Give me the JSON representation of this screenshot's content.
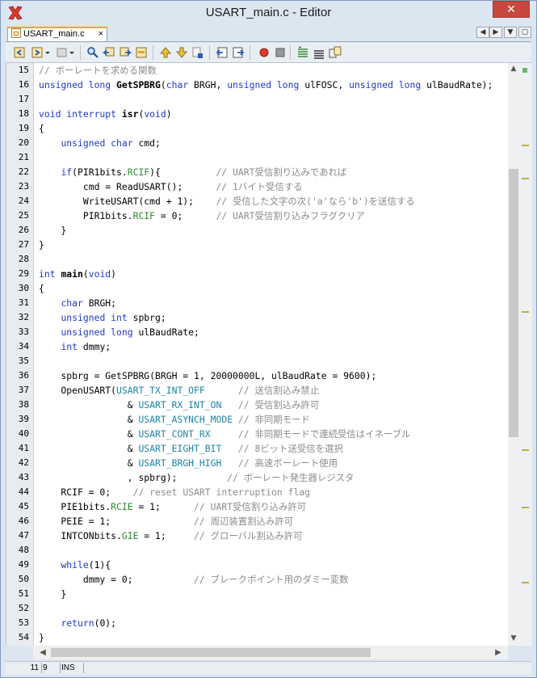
{
  "window": {
    "title": "USART_main.c - Editor",
    "close_glyph": "✕"
  },
  "tab": {
    "label": "USART_main.c",
    "close_glyph": "×"
  },
  "tab_nav": {
    "prev": "◀",
    "next": "▶",
    "list": "▼",
    "maximize": "▢"
  },
  "toolbar_icons": [
    "back-icon",
    "forward-icon",
    "last-edit-icon",
    "find-icon",
    "find-prev-icon",
    "find-next-icon",
    "toggle-highlight-icon",
    "prev-bookmark-icon",
    "next-bookmark-icon",
    "toggle-bookmark-icon",
    "shift-left-icon",
    "shift-right-icon",
    "start-macro-icon",
    "stop-macro-icon",
    "comment-icon",
    "uncomment-icon",
    "diff-icon"
  ],
  "editor": {
    "current_line": 11,
    "lines": [
      {
        "n": "15",
        "segs": [
          [
            "cm",
            "// ボーレートを求める関数"
          ]
        ]
      },
      {
        "n": "16",
        "segs": [
          [
            "kw",
            "unsigned long "
          ],
          [
            "fn",
            "GetSPBRG"
          ],
          [
            "",
            "("
          ],
          [
            "kw",
            "char"
          ],
          [
            "",
            " BRGH, "
          ],
          [
            "kw",
            "unsigned long"
          ],
          [
            "",
            " ulFOSC, "
          ],
          [
            "kw",
            "unsigned long"
          ],
          [
            "",
            " ulBaudRate);"
          ]
        ]
      },
      {
        "n": "17",
        "segs": []
      },
      {
        "n": "18",
        "segs": [
          [
            "kw",
            "void interrupt "
          ],
          [
            "fn",
            "isr"
          ],
          [
            "",
            "("
          ],
          [
            "kw",
            "void"
          ],
          [
            "",
            ")"
          ]
        ]
      },
      {
        "n": "19",
        "segs": [
          [
            "",
            "{"
          ]
        ]
      },
      {
        "n": "20",
        "segs": [
          [
            "",
            "    "
          ],
          [
            "kw",
            "unsigned char"
          ],
          [
            "",
            " cmd;"
          ]
        ]
      },
      {
        "n": "21",
        "segs": []
      },
      {
        "n": "22",
        "segs": [
          [
            "",
            "    "
          ],
          [
            "kw",
            "if"
          ],
          [
            "",
            "(PIR1bits."
          ],
          [
            "gr",
            "RCIF"
          ],
          [
            "",
            "){          "
          ],
          [
            "cm",
            "// UART受信割り込みであれば"
          ]
        ]
      },
      {
        "n": "23",
        "segs": [
          [
            "",
            "        cmd = ReadUSART();      "
          ],
          [
            "cm",
            "// 1バイト受信する"
          ]
        ]
      },
      {
        "n": "24",
        "segs": [
          [
            "",
            "        WriteUSART(cmd + 1);    "
          ],
          [
            "cm",
            "// 受信した文字の次('a'なら'b')を送信する"
          ]
        ]
      },
      {
        "n": "25",
        "segs": [
          [
            "",
            "        PIR1bits."
          ],
          [
            "gr",
            "RCIF"
          ],
          [
            "",
            " = 0;      "
          ],
          [
            "cm",
            "// UART受信割り込みフラグクリア"
          ]
        ]
      },
      {
        "n": "26",
        "segs": [
          [
            "",
            "    }"
          ]
        ]
      },
      {
        "n": "27",
        "segs": [
          [
            "",
            "}"
          ]
        ]
      },
      {
        "n": "28",
        "segs": []
      },
      {
        "n": "29",
        "segs": [
          [
            "kw",
            "int "
          ],
          [
            "fn",
            "main"
          ],
          [
            "",
            "("
          ],
          [
            "kw",
            "void"
          ],
          [
            "",
            ")"
          ]
        ]
      },
      {
        "n": "30",
        "segs": [
          [
            "",
            "{"
          ]
        ]
      },
      {
        "n": "31",
        "segs": [
          [
            "",
            "    "
          ],
          [
            "kw",
            "char"
          ],
          [
            "",
            " BRGH;"
          ]
        ]
      },
      {
        "n": "32",
        "segs": [
          [
            "",
            "    "
          ],
          [
            "kw",
            "unsigned int"
          ],
          [
            "",
            " spbrg;"
          ]
        ]
      },
      {
        "n": "33",
        "segs": [
          [
            "",
            "    "
          ],
          [
            "kw",
            "unsigned long"
          ],
          [
            "",
            " ulBaudRate;"
          ]
        ]
      },
      {
        "n": "34",
        "segs": [
          [
            "",
            "    "
          ],
          [
            "kw",
            "int"
          ],
          [
            "",
            " dmmy;"
          ]
        ]
      },
      {
        "n": "35",
        "segs": []
      },
      {
        "n": "36",
        "segs": [
          [
            "",
            "    spbrg = GetSPBRG(BRGH = 1, 20000000L, ulBaudRate = 9600);"
          ]
        ]
      },
      {
        "n": "37",
        "segs": [
          [
            "",
            "    OpenUSART("
          ],
          [
            "cy",
            "USART_TX_INT_OFF"
          ],
          [
            "",
            "      "
          ],
          [
            "cm",
            "// 送信割込み禁止"
          ]
        ]
      },
      {
        "n": "38",
        "segs": [
          [
            "",
            "                & "
          ],
          [
            "cy",
            "USART_RX_INT_ON"
          ],
          [
            "",
            "   "
          ],
          [
            "cm",
            "// 受信割込み許可"
          ]
        ]
      },
      {
        "n": "39",
        "segs": [
          [
            "",
            "                & "
          ],
          [
            "cy",
            "USART_ASYNCH_MODE"
          ],
          [
            "",
            " "
          ],
          [
            "cm",
            "// 非同期モード"
          ]
        ]
      },
      {
        "n": "40",
        "segs": [
          [
            "",
            "                & "
          ],
          [
            "cy",
            "USART_CONT_RX"
          ],
          [
            "",
            "     "
          ],
          [
            "cm",
            "// 非同期モードで連続受信はイネーブル"
          ]
        ]
      },
      {
        "n": "41",
        "segs": [
          [
            "",
            "                & "
          ],
          [
            "cy",
            "USART_EIGHT_BIT"
          ],
          [
            "",
            "   "
          ],
          [
            "cm",
            "// 8ビット送受信を選択"
          ]
        ]
      },
      {
        "n": "42",
        "segs": [
          [
            "",
            "                & "
          ],
          [
            "cy",
            "USART_BRGH_HIGH"
          ],
          [
            "",
            "   "
          ],
          [
            "cm",
            "// 高速ボーレート使用"
          ]
        ]
      },
      {
        "n": "43",
        "segs": [
          [
            "",
            "                , spbrg);         "
          ],
          [
            "cm",
            "// ボーレート発生器レジスタ"
          ]
        ]
      },
      {
        "n": "44",
        "segs": [
          [
            "",
            "    RCIF = 0;    "
          ],
          [
            "cm",
            "// reset USART interruption flag"
          ]
        ]
      },
      {
        "n": "45",
        "segs": [
          [
            "",
            "    PIE1bits."
          ],
          [
            "gr",
            "RCIE"
          ],
          [
            "",
            " = 1;      "
          ],
          [
            "cm",
            "// UART受信割り込み許可"
          ]
        ]
      },
      {
        "n": "46",
        "segs": [
          [
            "",
            "    PEIE = 1;               "
          ],
          [
            "cm",
            "// 周辺装置割込み許可"
          ]
        ]
      },
      {
        "n": "47",
        "segs": [
          [
            "",
            "    INTCONbits."
          ],
          [
            "gr",
            "GIE"
          ],
          [
            "",
            " = 1;     "
          ],
          [
            "cm",
            "// グローバル割込み許可"
          ]
        ]
      },
      {
        "n": "48",
        "segs": []
      },
      {
        "n": "49",
        "segs": [
          [
            "",
            "    "
          ],
          [
            "kw",
            "while"
          ],
          [
            "",
            "(1){"
          ]
        ]
      },
      {
        "n": "50",
        "segs": [
          [
            "",
            "        dmmy = 0;           "
          ],
          [
            "cm",
            "// ブレークポイント用のダミー変数"
          ]
        ]
      },
      {
        "n": "51",
        "segs": [
          [
            "",
            "    }"
          ]
        ]
      },
      {
        "n": "52",
        "segs": []
      },
      {
        "n": "53",
        "segs": [
          [
            "",
            "    "
          ],
          [
            "kw",
            "return"
          ],
          [
            "",
            "(0);"
          ]
        ]
      },
      {
        "n": "54",
        "segs": [
          [
            "",
            "}"
          ]
        ]
      }
    ]
  },
  "scroll": {
    "up": "▲",
    "down": "▼",
    "left": "◀",
    "right": "▶"
  },
  "status": {
    "line": "11",
    "column": "9",
    "mode": "INS"
  },
  "colors": {
    "keyword": "#1f39c8",
    "comment": "#8b8b8b",
    "sfr_bit": "#2d8a2d",
    "macro": "#1c84a3"
  }
}
